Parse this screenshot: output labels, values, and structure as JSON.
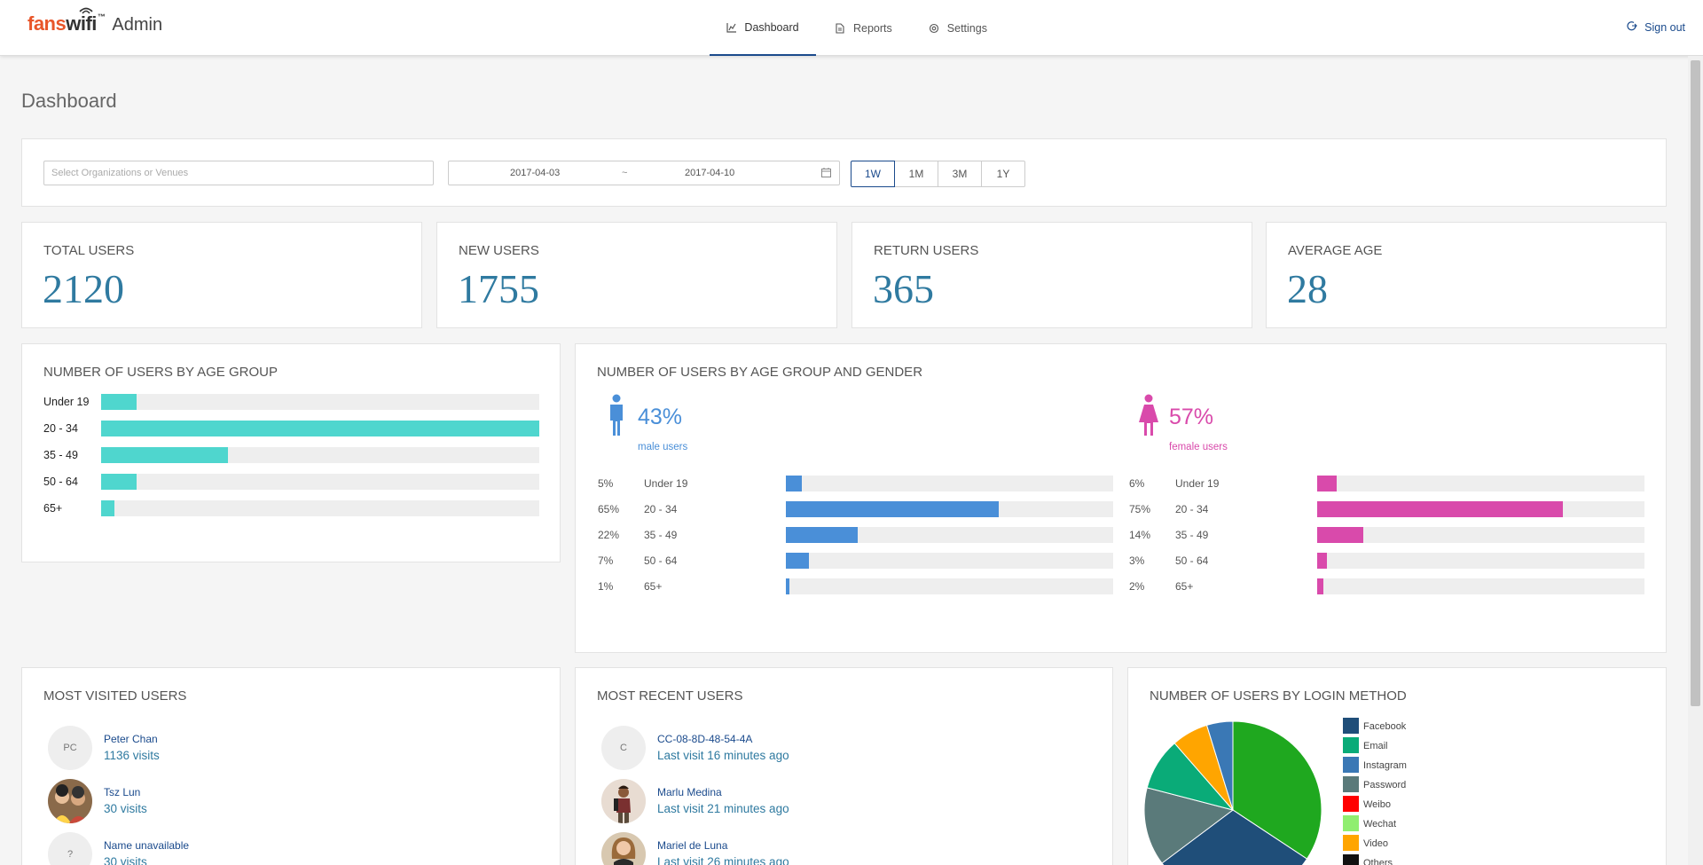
{
  "header": {
    "logo_fans": "fans",
    "logo_wifi": "wifi",
    "logo_tm": "™",
    "logo_admin": "Admin",
    "nav": [
      {
        "label": "Dashboard",
        "icon": "chart-icon",
        "active": true
      },
      {
        "label": "Reports",
        "icon": "document-icon",
        "active": false
      },
      {
        "label": "Settings",
        "icon": "gear-icon",
        "active": false
      }
    ],
    "signout_label": "Sign out"
  },
  "page_title": "Dashboard",
  "filters": {
    "org_placeholder": "Select Organizations or Venues",
    "date_start": "2017-04-03",
    "date_separator": "~",
    "date_end": "2017-04-10",
    "ranges": [
      "1W",
      "1M",
      "3M",
      "1Y"
    ],
    "active_range": "1W"
  },
  "stats": [
    {
      "label": "TOTAL USERS",
      "value": "2120"
    },
    {
      "label": "NEW USERS",
      "value": "1755"
    },
    {
      "label": "RETURN USERS",
      "value": "365"
    },
    {
      "label": "AVERAGE AGE",
      "value": "28"
    }
  ],
  "age_group": {
    "title": "NUMBER OF USERS BY AGE GROUP",
    "rows": [
      {
        "label": "Under 19",
        "fraction": 0.08
      },
      {
        "label": "20 - 34",
        "fraction": 1.0
      },
      {
        "label": "35 - 49",
        "fraction": 0.29
      },
      {
        "label": "50 - 64",
        "fraction": 0.08
      },
      {
        "label": "65+",
        "fraction": 0.03
      }
    ],
    "color": "#4fd6ce"
  },
  "gender": {
    "title": "NUMBER OF USERS BY AGE GROUP AND GENDER",
    "male": {
      "pct": "43%",
      "sub": "male users",
      "color": "#4a8fd8",
      "icon": "male-person-icon",
      "rows": [
        {
          "pct": "5%",
          "label": "Under 19",
          "fraction": 0.05
        },
        {
          "pct": "65%",
          "label": "20 - 34",
          "fraction": 0.65
        },
        {
          "pct": "22%",
          "label": "35 - 49",
          "fraction": 0.22
        },
        {
          "pct": "7%",
          "label": "50 - 64",
          "fraction": 0.07
        },
        {
          "pct": "1%",
          "label": "65+",
          "fraction": 0.01
        }
      ]
    },
    "female": {
      "pct": "57%",
      "sub": "female users",
      "color": "#d94aab",
      "icon": "female-person-icon",
      "rows": [
        {
          "pct": "6%",
          "label": "Under 19",
          "fraction": 0.06
        },
        {
          "pct": "75%",
          "label": "20 - 34",
          "fraction": 0.75
        },
        {
          "pct": "14%",
          "label": "35 - 49",
          "fraction": 0.14
        },
        {
          "pct": "3%",
          "label": "50 - 64",
          "fraction": 0.03
        },
        {
          "pct": "2%",
          "label": "65+",
          "fraction": 0.02
        }
      ]
    }
  },
  "most_visited": {
    "title": "MOST VISITED USERS",
    "users": [
      {
        "avatar": "PC",
        "name": "Peter Chan",
        "sub": "1136 visits"
      },
      {
        "avatar": "",
        "name": "Tsz Lun",
        "sub": "30 visits"
      },
      {
        "avatar": "?",
        "name": "Name unavailable",
        "sub": "30 visits"
      }
    ]
  },
  "most_recent": {
    "title": "MOST RECENT USERS",
    "users": [
      {
        "avatar": "C",
        "name": "CC-08-8D-48-54-4A",
        "sub": "Last visit 16 minutes ago"
      },
      {
        "avatar": "",
        "name": "Marlu Medina",
        "sub": "Last visit 21 minutes ago"
      },
      {
        "avatar": "",
        "name": "Mariel de Luna",
        "sub": "Last visit 26 minutes ago"
      }
    ]
  },
  "login_method": {
    "title": "NUMBER OF USERS BY LOGIN METHOD"
  },
  "chart_data": {
    "type": "pie",
    "title": "NUMBER OF USERS BY LOGIN METHOD",
    "categories": [
      "Facebook",
      "Email",
      "Instagram",
      "Password",
      "Weibo",
      "Wechat",
      "Video",
      "Others"
    ],
    "colors": [
      "#1f4e79",
      "#0aab78",
      "#3a78b5",
      "#5a7a7a",
      "#ff0000",
      "#90ee70",
      "#ffa500",
      "#111111"
    ],
    "values": [
      32,
      10,
      5,
      15,
      0,
      0,
      7,
      0
    ],
    "extra_slices": [
      {
        "color": "#1fa81f",
        "value": 36
      }
    ],
    "legend_placement": "right"
  }
}
